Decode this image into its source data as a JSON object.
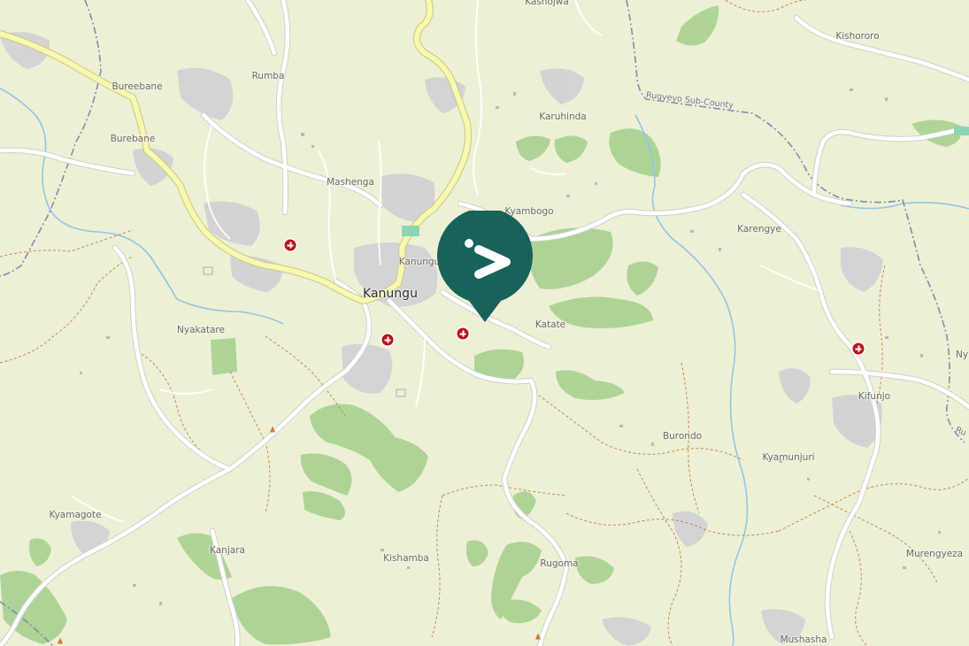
{
  "map": {
    "places": [
      {
        "id": "kashojwa",
        "name": "Kashojwa",
        "type": "village"
      },
      {
        "id": "kishororo",
        "name": "Kishororo",
        "type": "village"
      },
      {
        "id": "bureebane",
        "name": "Bureebane",
        "type": "village"
      },
      {
        "id": "rumba",
        "name": "Rumba",
        "type": "village"
      },
      {
        "id": "karuhinda",
        "name": "Karuhinda",
        "type": "village"
      },
      {
        "id": "burebane",
        "name": "Burebane",
        "type": "village"
      },
      {
        "id": "mashenga",
        "name": "Mashenga",
        "type": "village"
      },
      {
        "id": "kyambogo",
        "name": "Kyambogo",
        "type": "village"
      },
      {
        "id": "karengye",
        "name": "Karengye",
        "type": "village"
      },
      {
        "id": "kanungu-small",
        "name": "Kanungu",
        "type": "village"
      },
      {
        "id": "kanungu",
        "name": "Kanungu",
        "type": "town"
      },
      {
        "id": "nyakatare",
        "name": "Nyakatare",
        "type": "village"
      },
      {
        "id": "katate",
        "name": "Katate",
        "type": "village"
      },
      {
        "id": "kifunjo",
        "name": "Kifunjo",
        "type": "village"
      },
      {
        "id": "burondo",
        "name": "Burondo",
        "type": "village"
      },
      {
        "id": "kyamunjuri",
        "name": "Kyamunjuri",
        "type": "village"
      },
      {
        "id": "kyamagote",
        "name": "Kyamagote",
        "type": "village"
      },
      {
        "id": "kanjara",
        "name": "Kanjara",
        "type": "village"
      },
      {
        "id": "kishamba",
        "name": "Kishamba",
        "type": "village"
      },
      {
        "id": "rugoma",
        "name": "Rugoma",
        "type": "village"
      },
      {
        "id": "murengyeza",
        "name": "Murengyeza",
        "type": "village"
      },
      {
        "id": "mushasha",
        "name": "Mushasha",
        "type": "village"
      },
      {
        "id": "ny",
        "name": "Ny",
        "type": "village"
      }
    ],
    "admin_labels": [
      {
        "id": "rugyeyo",
        "name": "Rugyeyo Sub-County"
      },
      {
        "id": "ru-edge",
        "name": "Ru"
      }
    ],
    "pois": [
      {
        "id": "h1",
        "type": "hospital"
      },
      {
        "id": "h2",
        "type": "hospital"
      },
      {
        "id": "h3",
        "type": "hospital"
      },
      {
        "id": "h4",
        "type": "hospital"
      }
    ],
    "peaks": [
      {
        "id": "p1",
        "type": "peak"
      },
      {
        "id": "p2",
        "type": "peak"
      },
      {
        "id": "p3",
        "type": "peak"
      }
    ],
    "marker": {
      "icon": "location-pin-icon",
      "color": "#17625a"
    },
    "colors": {
      "land": "#eef0d5",
      "forest": "#a6d190",
      "primary_road": "#f7f9ad",
      "primary_casing": "#c9c68a",
      "minor_road": "#ffffff",
      "road_casing": "#cfcfcf",
      "water": "#90c6e8",
      "admin_border": "#8a8aa8",
      "track": "#b47c3c",
      "settlement": "#cfcfd6"
    }
  }
}
